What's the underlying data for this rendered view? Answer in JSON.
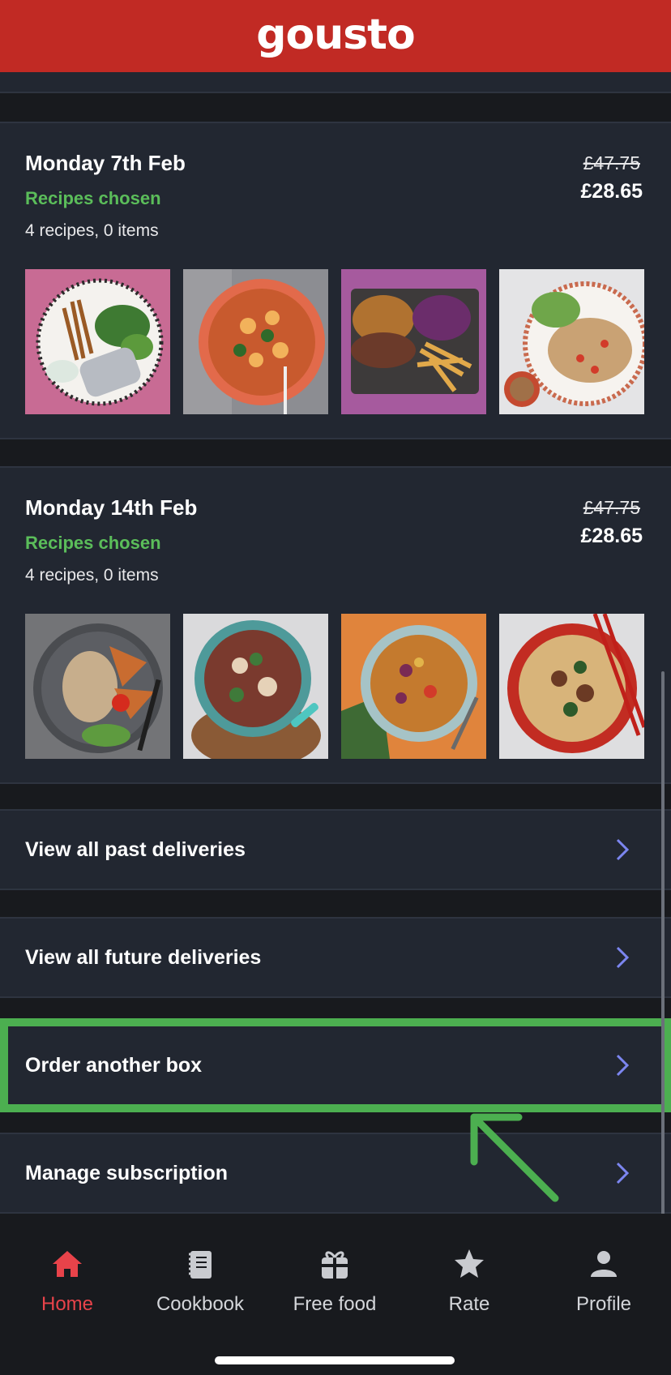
{
  "header": {
    "logo": "gousto",
    "color": "#c12a24"
  },
  "deliveries": [
    {
      "date": "Monday 7th Feb",
      "status": "Recipes chosen",
      "count": "4 recipes, 0 items",
      "old_price": "£47.75",
      "price": "£28.65"
    },
    {
      "date": "Monday 14th Feb",
      "status": "Recipes chosen",
      "count": "4 recipes, 0 items",
      "old_price": "£47.75",
      "price": "£28.65"
    }
  ],
  "links": {
    "past": "View all past deliveries",
    "future": "View all future deliveries",
    "order": "Order another box",
    "manage": "Manage subscription"
  },
  "tabs": [
    {
      "label": "Home",
      "icon": "home-icon",
      "active": true
    },
    {
      "label": "Cookbook",
      "icon": "cookbook-icon",
      "active": false
    },
    {
      "label": "Free food",
      "icon": "gift-icon",
      "active": false
    },
    {
      "label": "Rate",
      "icon": "star-icon",
      "active": false
    },
    {
      "label": "Profile",
      "icon": "profile-icon",
      "active": false
    }
  ],
  "colors": {
    "accent_green": "#5bbd5a",
    "highlight_green": "#4caf50",
    "chevron": "#7c86f0",
    "active_tab": "#e8434a",
    "card": "#222731",
    "background": "#181a1e"
  }
}
